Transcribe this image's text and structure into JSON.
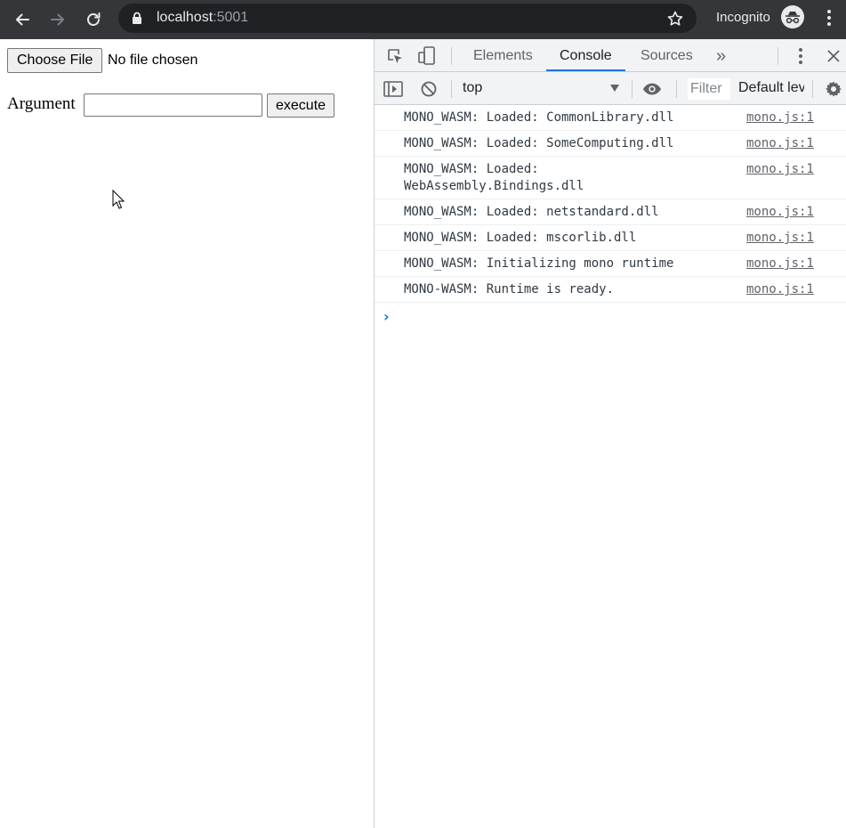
{
  "browser": {
    "url_host": "localhost",
    "url_port": ":5001",
    "incognito_label": "Incognito"
  },
  "page": {
    "file_button_label": "Choose File",
    "file_status": "No file chosen",
    "argument_label": "Argument",
    "argument_value": "",
    "execute_label": "execute"
  },
  "devtools": {
    "tabs": [
      "Elements",
      "Console",
      "Sources"
    ],
    "active_tab": "Console",
    "more_tabs": "»",
    "context": "top",
    "filter_placeholder": "Filter",
    "levels_label": "Default levels",
    "logs": [
      {
        "message": "MONO_WASM: Loaded: CommonLibrary.dll",
        "source": "mono.js:1"
      },
      {
        "message": "MONO_WASM: Loaded: SomeComputing.dll",
        "source": "mono.js:1"
      },
      {
        "message": "MONO_WASM: Loaded: WebAssembly.Bindings.dll",
        "source": "mono.js:1"
      },
      {
        "message": "MONO_WASM: Loaded: netstandard.dll",
        "source": "mono.js:1"
      },
      {
        "message": "MONO_WASM: Loaded: mscorlib.dll",
        "source": "mono.js:1"
      },
      {
        "message": "MONO_WASM: Initializing mono runtime",
        "source": "mono.js:1"
      },
      {
        "message": "MONO-WASM: Runtime is ready.",
        "source": "mono.js:1"
      }
    ],
    "prompt_symbol": "›"
  },
  "colors": {
    "chrome_bg": "#35363a",
    "omnibox_bg": "#202124",
    "accent": "#1a73e8"
  }
}
